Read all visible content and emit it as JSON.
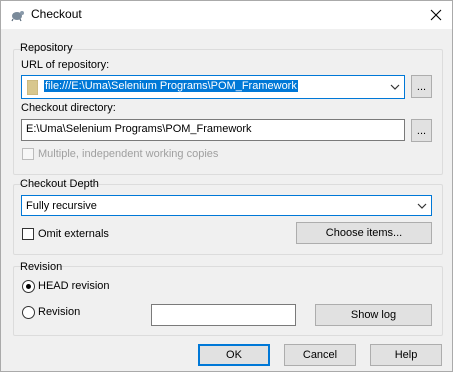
{
  "window": {
    "title": "Checkout",
    "close_symbol": "✕"
  },
  "repository": {
    "group_label": "Repository",
    "url_label": "URL of repository:",
    "url_value": "file:///E:\\Uma\\Selenium Programs\\POM_Framework",
    "browse_label": "...",
    "checkout_dir_label": "Checkout directory:",
    "checkout_dir_value": "E:\\Uma\\Selenium Programs\\POM_Framework",
    "dir_browse_label": "...",
    "multiple_copies_label": "Multiple, independent working copies"
  },
  "depth": {
    "group_label": "Checkout Depth",
    "selected": "Fully recursive",
    "omit_externals_label": "Omit externals",
    "choose_items_label": "Choose items..."
  },
  "revision": {
    "group_label": "Revision",
    "head_label": "HEAD revision",
    "revision_label": "Revision",
    "revision_value": "",
    "show_log_label": "Show log"
  },
  "buttons": {
    "ok": "OK",
    "cancel": "Cancel",
    "help": "Help"
  },
  "colors": {
    "accent": "#0078d7",
    "folder_icon": "#d8c78e"
  }
}
